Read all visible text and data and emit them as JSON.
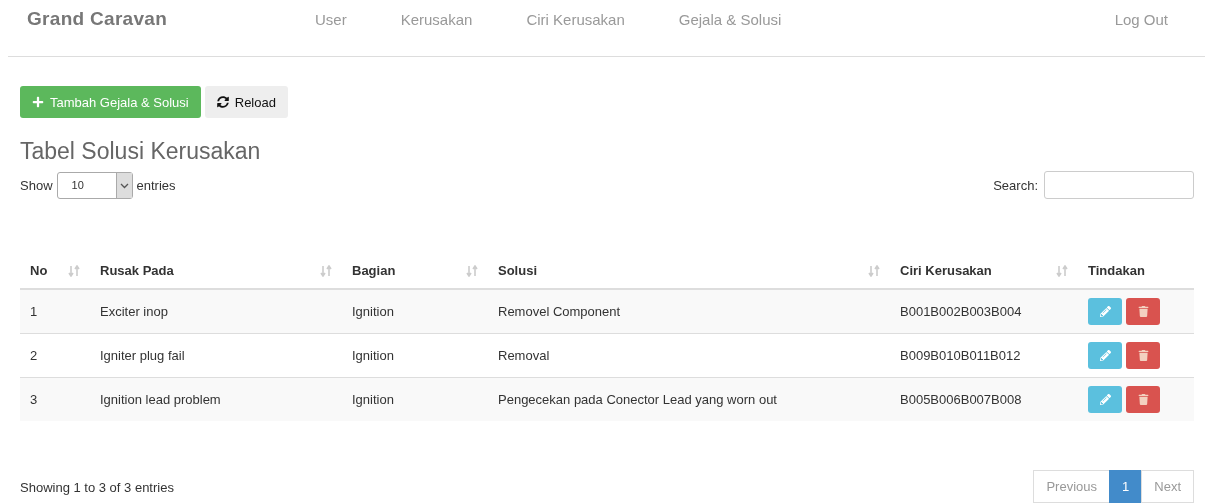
{
  "navbar": {
    "brand": "Grand Caravan",
    "items": [
      "User",
      "Kerusakan",
      "Ciri Kerusakan",
      "Gejala & Solusi"
    ],
    "logout": "Log Out"
  },
  "toolbar": [
    {
      "kind": "add",
      "label": "Tambah Gejala & Solusi"
    },
    {
      "kind": "reload",
      "label": "Reload"
    }
  ],
  "title": "Tabel Solusi Kerusakan",
  "length": {
    "before": "Show",
    "value": "10",
    "after": "entries"
  },
  "search": {
    "label": "Search:"
  },
  "table": {
    "columns": [
      {
        "label": "No",
        "sortable": true
      },
      {
        "label": "Rusak Pada",
        "sortable": true
      },
      {
        "label": "Bagian",
        "sortable": true
      },
      {
        "label": "Solusi",
        "sortable": true
      },
      {
        "label": "Ciri Kerusakan",
        "sortable": true
      },
      {
        "label": "Tindakan",
        "sortable": false
      }
    ],
    "rows": [
      [
        "1",
        "Exciter inop",
        "Ignition",
        "Removel Component",
        "B001B002B003B004"
      ],
      [
        "2",
        "Igniter plug fail",
        "Ignition",
        "Removal",
        "B009B010B011B012"
      ],
      [
        "3",
        "Ignition lead problem",
        "Ignition",
        "Pengecekan pada Conector Lead yang worn out",
        "B005B006B007B008"
      ]
    ]
  },
  "info": "Showing 1 to 3 of 3 entries",
  "pagination": [
    {
      "label": "Previous",
      "selected": false,
      "disabled": true
    },
    {
      "label": "1",
      "selected": true,
      "disabled": false
    },
    {
      "label": "Next",
      "selected": false,
      "disabled": true
    }
  ]
}
